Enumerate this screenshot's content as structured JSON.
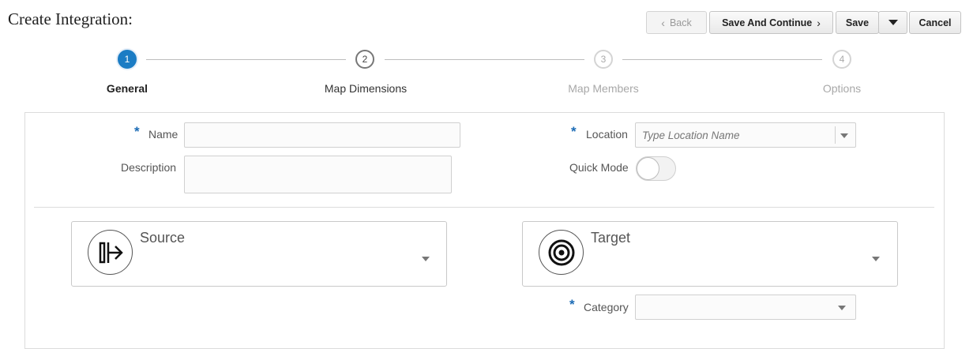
{
  "page": {
    "title": "Create Integration:"
  },
  "toolbar": {
    "back_label": "Back",
    "save_continue_label": "Save And Continue",
    "save_label": "Save",
    "cancel_label": "Cancel"
  },
  "steps": [
    {
      "number": "1",
      "label": "General",
      "state": "active"
    },
    {
      "number": "2",
      "label": "Map Dimensions",
      "state": "next"
    },
    {
      "number": "3",
      "label": "Map Members",
      "state": "future"
    },
    {
      "number": "4",
      "label": "Options",
      "state": "future"
    }
  ],
  "form": {
    "required_marker": "*",
    "name": {
      "label": "Name",
      "value": ""
    },
    "description": {
      "label": "Description",
      "value": ""
    },
    "location": {
      "label": "Location",
      "value": "",
      "placeholder": "Type Location Name"
    },
    "quick_mode": {
      "label": "Quick Mode",
      "enabled": false
    },
    "category": {
      "label": "Category",
      "value": ""
    }
  },
  "source": {
    "title": "Source",
    "icon": "source-import-icon"
  },
  "target": {
    "title": "Target",
    "icon": "target-bullseye-icon"
  },
  "colors": {
    "accent": "#1b7cc4",
    "required": "#1b6bb5"
  }
}
